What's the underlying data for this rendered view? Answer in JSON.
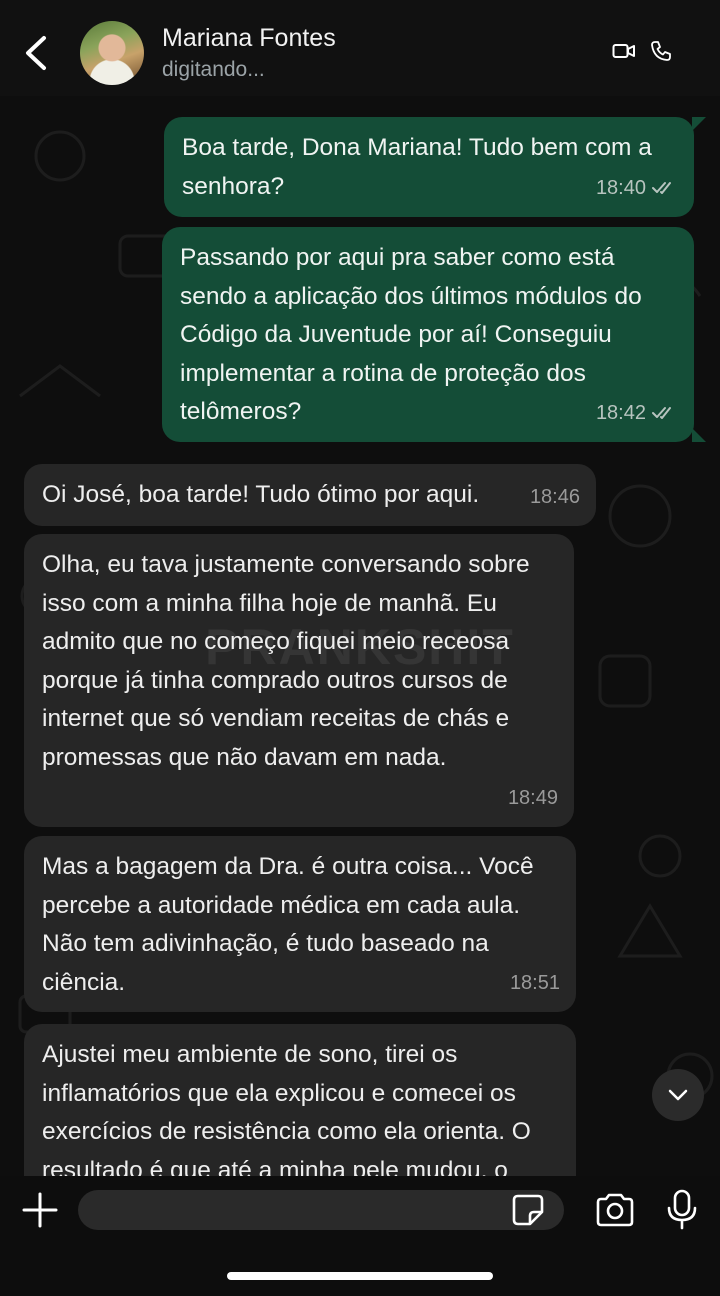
{
  "header": {
    "contact_name": "Mariana Fontes",
    "status": "digitando...",
    "icons": [
      "back-icon",
      "video-call-icon",
      "phone-icon"
    ]
  },
  "watermark": "PRANKSHIT",
  "messages": [
    {
      "direction": "out",
      "text": "Boa tarde, Dona Mariana! Tudo bem com a senhora?",
      "time": "18:40",
      "status": "read"
    },
    {
      "direction": "out",
      "text": "Passando por aqui pra saber como está sendo a aplicação dos últimos módulos do Código da Juventude por aí! Conseguiu implementar a rotina de proteção dos telômeros?",
      "time": "18:42",
      "status": "read"
    },
    {
      "direction": "in",
      "text": "Oi José, boa tarde! Tudo ótimo por aqui.",
      "time": "18:46"
    },
    {
      "direction": "in",
      "text": "Olha, eu tava justamente conversando sobre isso com a minha filha hoje de manhã. Eu admito que no começo fiquei meio receosa porque já tinha comprado outros cursos de internet que só vendiam receitas de chás e promessas que não davam em nada.",
      "time": "18:49"
    },
    {
      "direction": "in",
      "text": "Mas a bagagem da Dra. é outra coisa... Você percebe a autoridade médica em cada aula. Não tem adivinhação, é tudo baseado na ciência.",
      "time": "18:51"
    },
    {
      "direction": "in",
      "text": "Ajustei meu ambiente de sono, tirei os inflamatórios que ela explicou e comecei os exercícios de resistência como ela orienta. O resultado é que até a minha pele mudou, o",
      "time": ""
    }
  ],
  "composer": {
    "placeholder": "",
    "icons": [
      "plus-icon",
      "sticker-icon",
      "camera-icon",
      "microphone-icon"
    ]
  },
  "colors": {
    "outgoing_bubble": "#144d37",
    "incoming_bubble": "#262626",
    "background": "#0e0e0e"
  }
}
